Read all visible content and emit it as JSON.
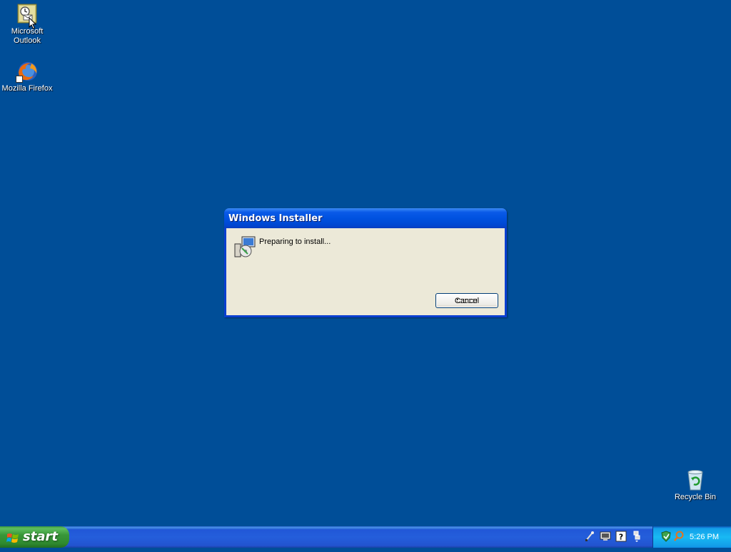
{
  "desktop": {
    "icons": [
      {
        "label_line1": "Microsoft",
        "label_line2": "Outlook"
      },
      {
        "label": "Mozilla Firefox"
      },
      {
        "label": "Recycle Bin"
      }
    ]
  },
  "dialog": {
    "title": "Windows Installer",
    "message": "Preparing to install...",
    "cancel_label": "Cancel"
  },
  "taskbar": {
    "start_label": "start",
    "clock": "5:26 PM",
    "tray_icons": [
      "network-tool-icon",
      "display-icon",
      "help-icon",
      "network-connection-icon"
    ],
    "notif_icons": [
      "shield-icon",
      "search-icon"
    ]
  },
  "colors": {
    "desktop_bg": "#004e98",
    "taskbar": "#245edb",
    "start_green": "#3c9a3c",
    "dialog_face": "#ece9d8"
  }
}
